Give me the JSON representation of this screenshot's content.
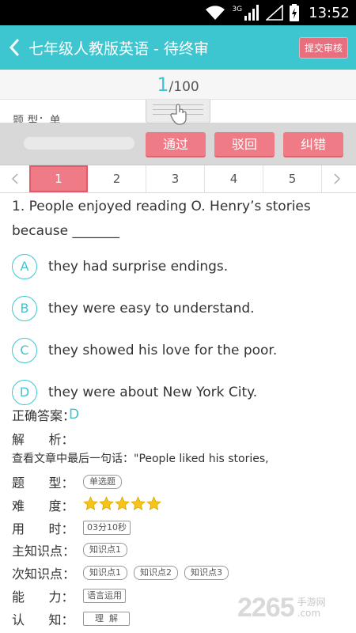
{
  "status": {
    "time": "13:52",
    "network": "3G"
  },
  "header": {
    "title": "七年级人教版英语 - 待终审",
    "submit_label": "提交审核"
  },
  "progress": {
    "current": "1",
    "total": "/100"
  },
  "peek_text": "题 型：单",
  "review": {
    "pass": "通过",
    "reject": "驳回",
    "correct": "纠错"
  },
  "tabs": [
    "1",
    "2",
    "3",
    "4",
    "5"
  ],
  "active_tab": 0,
  "question": {
    "text": "1.  People enjoyed reading O. Henry’s stories because  _______"
  },
  "options": [
    {
      "letter": "A",
      "text": "they had surprise endings."
    },
    {
      "letter": "B",
      "text": "they were easy to understand."
    },
    {
      "letter": "C",
      "text": "they showed his love for the poor."
    },
    {
      "letter": "D",
      "text": "they were about New York City."
    }
  ],
  "answer": {
    "label": "正确答案：",
    "value": "D"
  },
  "analysis": {
    "label": "解      析：",
    "text": "查看文章中最后一句话：\"People liked his stories,"
  },
  "type": {
    "label": "题      型：",
    "value": "单选题"
  },
  "difficulty": {
    "label": "难      度：",
    "stars": 5,
    "star_color": "#f5c518"
  },
  "time_used": {
    "label": "用      时：",
    "value": "03分10秒"
  },
  "main_point": {
    "label": "主知识点：",
    "value": "知识点1"
  },
  "sub_points": {
    "label": "次知识点：",
    "values": [
      "知识点1",
      "知识点2",
      "知识点3"
    ]
  },
  "ability": {
    "label": "能      力：",
    "value": "语言运用"
  },
  "cognition": {
    "label": "认      知：",
    "value": "理  解"
  },
  "watermark": {
    "number": "2265",
    "site": "手游网",
    "url": ".com"
  },
  "colors": {
    "accent": "#3dc6d0",
    "button": "#ef7b86"
  }
}
